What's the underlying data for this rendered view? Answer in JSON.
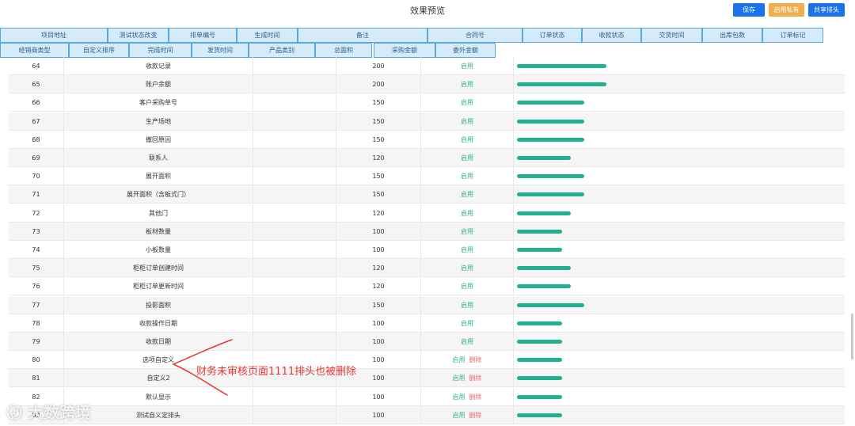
{
  "header": {
    "title": "效果预览",
    "save_label": "保存",
    "private_label": "启用私有",
    "share_label": "共享排头"
  },
  "chips_row1": [
    "项目地址",
    "测试状态改变",
    "排单编号",
    "生成时间",
    "备注",
    "合同号",
    "订单状态",
    "收款状态",
    "交货时间",
    "出库包数",
    "订单标记"
  ],
  "chips_row2": [
    "经销商类型",
    "自定义排序",
    "完成时间",
    "发货时间",
    "产品类别",
    "总面积",
    "采购金额",
    "委外金额"
  ],
  "table": {
    "rows": [
      {
        "idx": "64",
        "name": "收款记录",
        "width": "200",
        "enable": "启用",
        "delete": "",
        "bar": 200
      },
      {
        "idx": "65",
        "name": "账户余额",
        "width": "200",
        "enable": "启用",
        "delete": "",
        "bar": 200
      },
      {
        "idx": "66",
        "name": "客户采购单号",
        "width": "150",
        "enable": "启用",
        "delete": "",
        "bar": 150
      },
      {
        "idx": "67",
        "name": "生产场地",
        "width": "150",
        "enable": "启用",
        "delete": "",
        "bar": 150
      },
      {
        "idx": "68",
        "name": "撤回原因",
        "width": "150",
        "enable": "启用",
        "delete": "",
        "bar": 150
      },
      {
        "idx": "69",
        "name": "联系人",
        "width": "120",
        "enable": "启用",
        "delete": "",
        "bar": 120
      },
      {
        "idx": "70",
        "name": "展开面积",
        "width": "150",
        "enable": "启用",
        "delete": "",
        "bar": 150
      },
      {
        "idx": "71",
        "name": "展开面积（含板式门）",
        "width": "150",
        "enable": "启用",
        "delete": "",
        "bar": 150
      },
      {
        "idx": "72",
        "name": "其他门",
        "width": "120",
        "enable": "启用",
        "delete": "",
        "bar": 120
      },
      {
        "idx": "73",
        "name": "板材数量",
        "width": "100",
        "enable": "启用",
        "delete": "",
        "bar": 100
      },
      {
        "idx": "74",
        "name": "小板数量",
        "width": "100",
        "enable": "启用",
        "delete": "",
        "bar": 100
      },
      {
        "idx": "75",
        "name": "柜柜订单创建时间",
        "width": "120",
        "enable": "启用",
        "delete": "",
        "bar": 120
      },
      {
        "idx": "76",
        "name": "柜柜订单更新时间",
        "width": "120",
        "enable": "启用",
        "delete": "",
        "bar": 120
      },
      {
        "idx": "77",
        "name": "投影面积",
        "width": "150",
        "enable": "启用",
        "delete": "",
        "bar": 150
      },
      {
        "idx": "78",
        "name": "收款操作日期",
        "width": "100",
        "enable": "启用",
        "delete": "",
        "bar": 100
      },
      {
        "idx": "79",
        "name": "收款日期",
        "width": "100",
        "enable": "启用",
        "delete": "",
        "bar": 100
      },
      {
        "idx": "80",
        "name": "选项自定义",
        "width": "100",
        "enable": "启用",
        "delete": "删除",
        "bar": 100
      },
      {
        "idx": "81",
        "name": "自定义2",
        "width": "100",
        "enable": "启用",
        "delete": "删除",
        "bar": 100
      },
      {
        "idx": "82",
        "name": "默认显示",
        "width": "100",
        "enable": "启用",
        "delete": "删除",
        "bar": 100
      },
      {
        "idx": "83",
        "name": "测试自义定排头",
        "width": "100",
        "enable": "启用",
        "delete": "删除",
        "bar": 100
      }
    ]
  },
  "annotation": {
    "text": "财务未审核页面1111排头也被删除"
  },
  "watermark": "大数跨境",
  "colors": {
    "primary": "#1a73e8",
    "warning": "#f0ad4e",
    "bar": "#22b08f",
    "enable": "#2fb394",
    "delete": "#e96a6a",
    "annotation": "#e53935"
  }
}
